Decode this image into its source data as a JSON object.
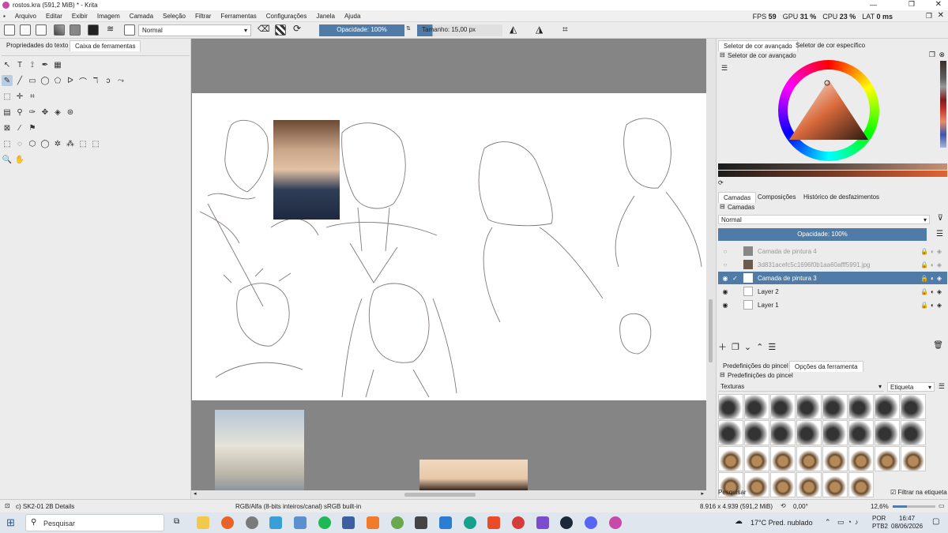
{
  "window": {
    "title": "rostos.kra (591,2 MiB) * - Krita"
  },
  "menu": [
    "Arquivo",
    "Editar",
    "Exibir",
    "Imagem",
    "Camada",
    "Seleção",
    "Filtrar",
    "Ferramentas",
    "Configurações",
    "Janela",
    "Ajuda"
  ],
  "stats": {
    "fps_label": "FPS",
    "fps": "59",
    "gpu_label": "GPU",
    "gpu": "31 %",
    "cpu_label": "CPU",
    "cpu": "23 %",
    "lat_label": "LAT",
    "lat": "0 ms"
  },
  "toolbar": {
    "blend_mode": "Normal",
    "opacity": "Opacidade: 100%",
    "size": "Tamanho: 15,00 px"
  },
  "left_tabs": [
    "Propriedades do texto",
    "Caixa de ferramentas"
  ],
  "right_top_tabs": [
    "Seletor de cor avançado",
    "Seletor de cor específico"
  ],
  "color_selector_title": "Seletor de cor avançado",
  "layer_tabs": [
    "Camadas",
    "Composições",
    "Histórico de desfazimentos"
  ],
  "layers_panel": {
    "title": "Camadas",
    "blend": "Normal",
    "opacity": "Opacidade: 100%",
    "layers": [
      {
        "name": "Camada de pintura 4",
        "visible": false,
        "active": false
      },
      {
        "name": "3d831acefc5c1696f0b1aa60afff5991.jpg",
        "visible": false,
        "active": false
      },
      {
        "name": "Camada de pintura 3",
        "visible": true,
        "active": true
      },
      {
        "name": "Layer 2",
        "visible": true,
        "active": false
      },
      {
        "name": "Layer 1",
        "visible": true,
        "active": false
      }
    ]
  },
  "brush_tabs": [
    "Predefinições do pincel",
    "Opções da ferramenta"
  ],
  "brush_panel": {
    "title": "Predefinições do pincel",
    "category": "Texturas",
    "tag": "Etiqueta",
    "search": "Pesquisar",
    "filter": "Filtrar na etiqueta"
  },
  "status": {
    "brush_name": "c) SK2-01 2B Details",
    "color_space": "RGB/Alfa (8-bits inteiros/canal)  sRGB built-in",
    "dims": "8.916 x 4.939 (591,2 MiB)",
    "rotation": "0,00°",
    "zoom": "12,6%"
  },
  "taskbar": {
    "search": "Pesquisar",
    "weather": "17°C  Pred. nublado",
    "lang1": "POR",
    "lang2": "PTB2",
    "time": "16:47",
    "date": "08/06/2026"
  },
  "colors": {
    "accent": "#4f7ba6",
    "canvas_bg": "#858585"
  }
}
